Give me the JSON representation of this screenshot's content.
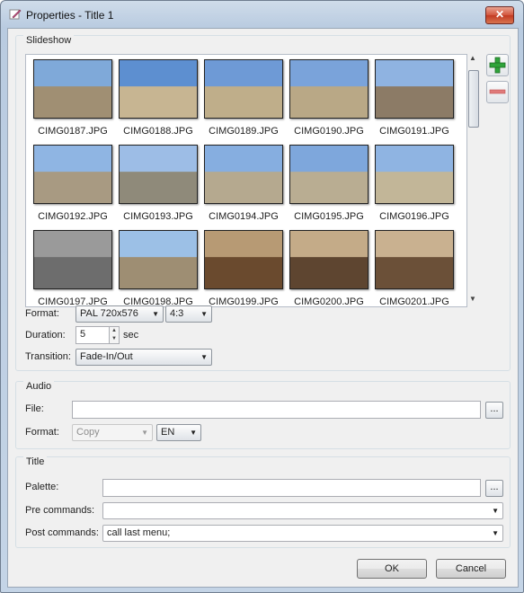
{
  "window": {
    "title": "Properties - Title 1",
    "close_glyph": "✕"
  },
  "slideshow": {
    "label": "Slideshow",
    "images": [
      {
        "name": "CIMG0187.JPG",
        "sky": "#7fa9d9",
        "ground": "#a08f73"
      },
      {
        "name": "CIMG0188.JPG",
        "sky": "#5d8fd0",
        "ground": "#c7b592"
      },
      {
        "name": "CIMG0189.JPG",
        "sky": "#6e9ad6",
        "ground": "#bfae8a"
      },
      {
        "name": "CIMG0190.JPG",
        "sky": "#7aa3da",
        "ground": "#b9a886"
      },
      {
        "name": "CIMG0191.JPG",
        "sky": "#8fb3e1",
        "ground": "#8c7b66"
      },
      {
        "name": "CIMG0192.JPG",
        "sky": "#8fb5e3",
        "ground": "#a89a82"
      },
      {
        "name": "CIMG0193.JPG",
        "sky": "#9dbde6",
        "ground": "#8f8a7a"
      },
      {
        "name": "CIMG0194.JPG",
        "sky": "#86aee0",
        "ground": "#b5a98f"
      },
      {
        "name": "CIMG0195.JPG",
        "sky": "#7ea7dc",
        "ground": "#b9ad92"
      },
      {
        "name": "CIMG0196.JPG",
        "sky": "#8fb4e2",
        "ground": "#c2b698"
      },
      {
        "name": "CIMG0197.JPG",
        "sky": "#9a9a9a",
        "ground": "#6d6d6d"
      },
      {
        "name": "CIMG0198.JPG",
        "sky": "#9cc0e6",
        "ground": "#9e8e73"
      },
      {
        "name": "CIMG0199.JPG",
        "sky": "#b79a74",
        "ground": "#6a4a2e"
      },
      {
        "name": "CIMG0200.JPG",
        "sky": "#c4ab88",
        "ground": "#5e4530"
      },
      {
        "name": "CIMG0201.JPG",
        "sky": "#c9b190",
        "ground": "#6b5038"
      }
    ],
    "format_label": "Format:",
    "format_value": "PAL 720x576",
    "aspect_value": "4:3",
    "duration_label": "Duration:",
    "duration_value": "5",
    "duration_unit": "sec",
    "transition_label": "Transition:",
    "transition_value": "Fade-In/Out"
  },
  "audio": {
    "label": "Audio",
    "file_label": "File:",
    "file_value": "",
    "format_label": "Format:",
    "format_value": "Copy",
    "lang_value": "EN"
  },
  "title_group": {
    "label": "Title",
    "palette_label": "Palette:",
    "palette_value": "",
    "pre_label": "Pre commands:",
    "pre_value": "",
    "post_label": "Post commands:",
    "post_value": "call last menu;"
  },
  "buttons": {
    "ok": "OK",
    "cancel": "Cancel",
    "browse": "..."
  },
  "colors": {
    "add": "#2fa33a",
    "remove": "#e07a7a"
  }
}
